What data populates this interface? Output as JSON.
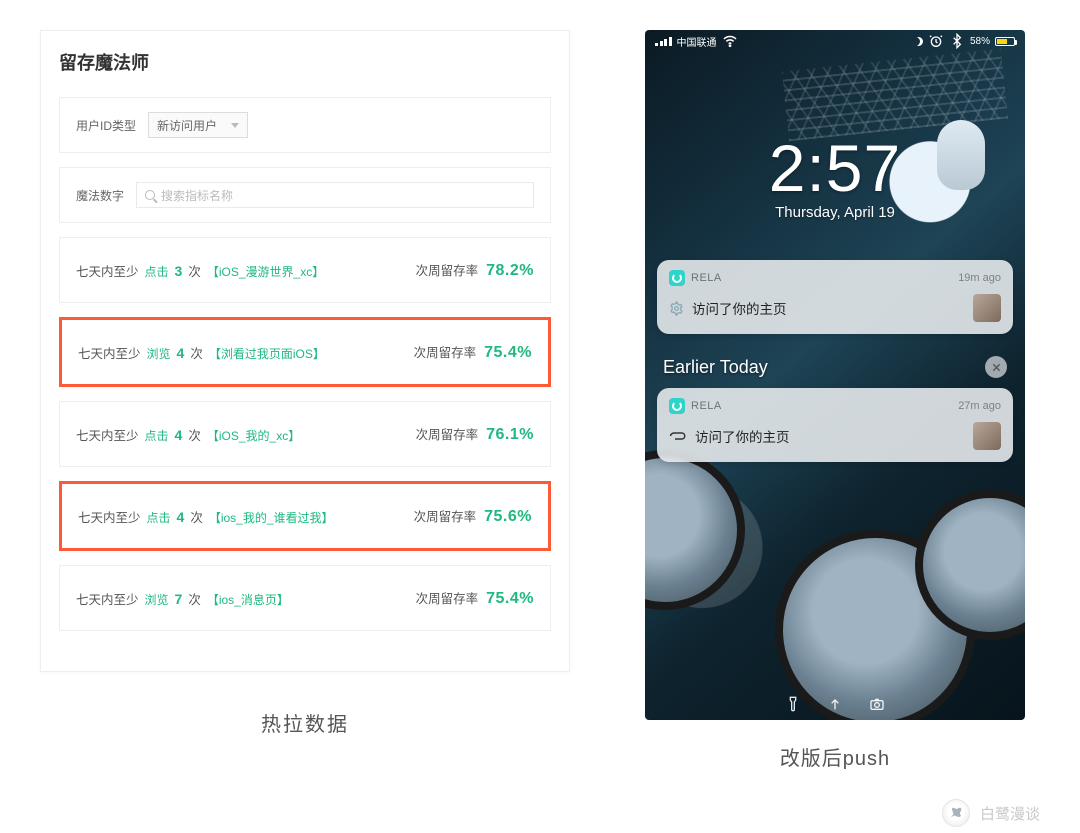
{
  "left": {
    "panel_title": "留存魔法师",
    "user_id_label": "用户ID类型",
    "user_id_value": "新访问用户",
    "magic_label": "魔法数字",
    "search_placeholder": "搜索指标名称",
    "items": [
      {
        "prefix": "七天内至少",
        "action": "点击",
        "count": "3",
        "unit": "次",
        "tag": "【iOS_漫游世界_xc】",
        "metric_label": "次周留存率",
        "pct": "78.2%",
        "hl": false
      },
      {
        "prefix": "七天内至少",
        "action": "浏览",
        "count": "4",
        "unit": "次",
        "tag": "【浏看过我页面iOS】",
        "metric_label": "次周留存率",
        "pct": "75.4%",
        "hl": true
      },
      {
        "prefix": "七天内至少",
        "action": "点击",
        "count": "4",
        "unit": "次",
        "tag": "【iOS_我的_xc】",
        "metric_label": "次周留存率",
        "pct": "76.1%",
        "hl": false
      },
      {
        "prefix": "七天内至少",
        "action": "点击",
        "count": "4",
        "unit": "次",
        "tag": "【ios_我的_谁看过我】",
        "metric_label": "次周留存率",
        "pct": "75.6%",
        "hl": true
      },
      {
        "prefix": "七天内至少",
        "action": "浏览",
        "count": "7",
        "unit": "次",
        "tag": "【ios_消息页】",
        "metric_label": "次周留存率",
        "pct": "75.4%",
        "hl": false
      }
    ],
    "caption": "热拉数据"
  },
  "right": {
    "carrier": "中国联通",
    "battery_pct": "58%",
    "time": "2:57",
    "date": "Thursday, April 19",
    "section_header": "Earlier Today",
    "notifs": [
      {
        "app": "RELA",
        "ago": "19m ago",
        "body": "访问了你的主页"
      },
      {
        "app": "RELA",
        "ago": "27m ago",
        "body": "访问了你的主页"
      }
    ],
    "caption": "改版后push"
  },
  "watermark": "白鹭漫谈"
}
